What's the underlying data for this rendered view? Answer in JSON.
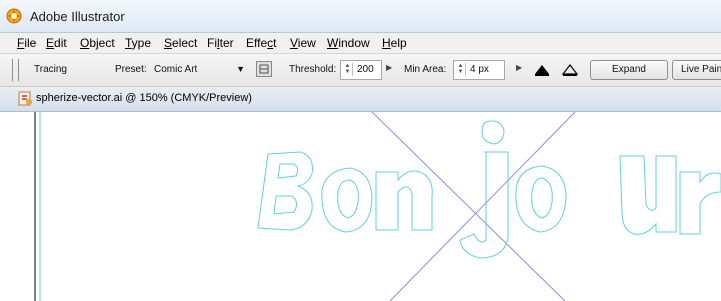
{
  "window": {
    "title": "Adobe Illustrator"
  },
  "menubar": {
    "items": [
      {
        "label": "File",
        "hotkey": "F"
      },
      {
        "label": "Edit",
        "hotkey": "E"
      },
      {
        "label": "Object",
        "hotkey": "O"
      },
      {
        "label": "Type",
        "hotkey": "T"
      },
      {
        "label": "Select",
        "hotkey": "S"
      },
      {
        "label": "Filter",
        "hotkey": "l"
      },
      {
        "label": "Effect",
        "hotkey": "c"
      },
      {
        "label": "View",
        "hotkey": "V"
      },
      {
        "label": "Window",
        "hotkey": "W"
      },
      {
        "label": "Help",
        "hotkey": "H"
      }
    ]
  },
  "controlbar": {
    "panel_label": "Tracing",
    "preset_label": "Preset:",
    "preset_value": "Comic Art",
    "threshold_label": "Threshold:",
    "threshold_value": "200",
    "min_area_label": "Min Area:",
    "min_area_value": "4 px",
    "expand_label": "Expand",
    "live_paint_label": "Live Paint"
  },
  "document": {
    "tab_title": "spherize-vector.ai @ 150% (CMYK/Preview)",
    "artwork_text": "Bonjour",
    "outline_color": "#5fd3e0",
    "guide_color": "#8c8ce0"
  },
  "icons": {
    "app": "illustrator-app-icon",
    "preset_options": "tracing-options-icon",
    "outline_mode": "outline-mode-icon",
    "fill_mode": "fill-mode-icon",
    "doc": "document-icon"
  }
}
